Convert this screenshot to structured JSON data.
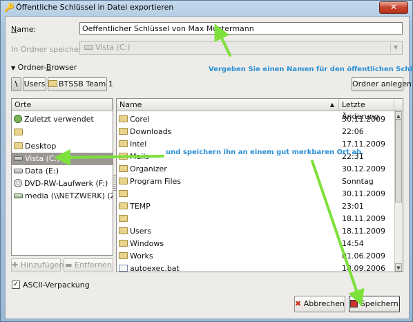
{
  "window": {
    "title": "Öffentliche Schlüssel in Datei exportieren",
    "close_label": "✕"
  },
  "name_field": {
    "label": "Name:",
    "label_underline": "N",
    "label_rest": "ame:",
    "value": "Oeffentlicher Schlüssel von Max Mustermann"
  },
  "folder_field": {
    "label": "In Ordner speichern:",
    "value": "Vista (C:)"
  },
  "folder_browser": {
    "label": "Ordner-Browser",
    "label_pre": "Ordner-",
    "label_underline": "B",
    "label_post": "rowser"
  },
  "path_bar": {
    "root": "\\",
    "segments": [
      "Users",
      "BTSSB Team 1"
    ],
    "create_folder": "Ordner anlegen"
  },
  "places": {
    "header": "Orte",
    "items": [
      {
        "label": "Zuletzt verwendet",
        "icon": "recent-icon"
      },
      {
        "label": "",
        "icon": "folder-icon"
      },
      {
        "label": "Desktop",
        "icon": "folder-icon"
      },
      {
        "label": "Vista (C:)",
        "icon": "drive-icon",
        "selected": true
      },
      {
        "label": "Data (E:)",
        "icon": "drive-icon"
      },
      {
        "label": "DVD-RW-Laufwerk (F:)",
        "icon": "dvd-icon"
      },
      {
        "label": "media (\\\\NETZWERK) (Z:)",
        "icon": "network-drive-icon"
      }
    ],
    "add_button": "Hinzufügen",
    "remove_button": "Entfernen"
  },
  "files": {
    "col_name": "Name",
    "col_date": "Letzte Änderung",
    "rows": [
      {
        "name": "Corel",
        "date": "30.11.2009",
        "icon": "folder-icon"
      },
      {
        "name": "Downloads",
        "date": "22:06",
        "icon": "folder-icon"
      },
      {
        "name": "Intel",
        "date": "17.11.2009",
        "icon": "folder-icon"
      },
      {
        "name": "Mails",
        "date": "22:31",
        "icon": "folder-icon"
      },
      {
        "name": "Organizer",
        "date": "30.12.2009",
        "icon": "folder-icon"
      },
      {
        "name": "Program Files",
        "date": "Sonntag",
        "icon": "folder-icon"
      },
      {
        "name": "",
        "date": "30.11.2009",
        "icon": "folder-icon"
      },
      {
        "name": "TEMP",
        "date": "23:01",
        "icon": "folder-icon"
      },
      {
        "name": "",
        "date": "18.11.2009",
        "icon": "folder-icon"
      },
      {
        "name": "Users",
        "date": "18.11.2009",
        "icon": "folder-icon"
      },
      {
        "name": "Windows",
        "date": "14:54",
        "icon": "folder-icon"
      },
      {
        "name": "Works",
        "date": "01.06.2009",
        "icon": "folder-icon"
      },
      {
        "name": "autoexec.bat",
        "date": "18.09.2006",
        "icon": "file-icon"
      }
    ]
  },
  "ascii_armor": {
    "label": "ASCII-Verpackung",
    "checked": true
  },
  "buttons": {
    "cancel": "Abbrechen",
    "save": "Speichern"
  },
  "annotations": {
    "name_hint": "Vergeben Sie einen Namen für den öffentlichen Schlüssel",
    "location_hint": "und speichern ihn an einem gut merkbaren Ort ab."
  },
  "colors": {
    "annotation_text": "#2a8fd6",
    "arrow": "#7ee03a",
    "selection": "#9b9893"
  }
}
